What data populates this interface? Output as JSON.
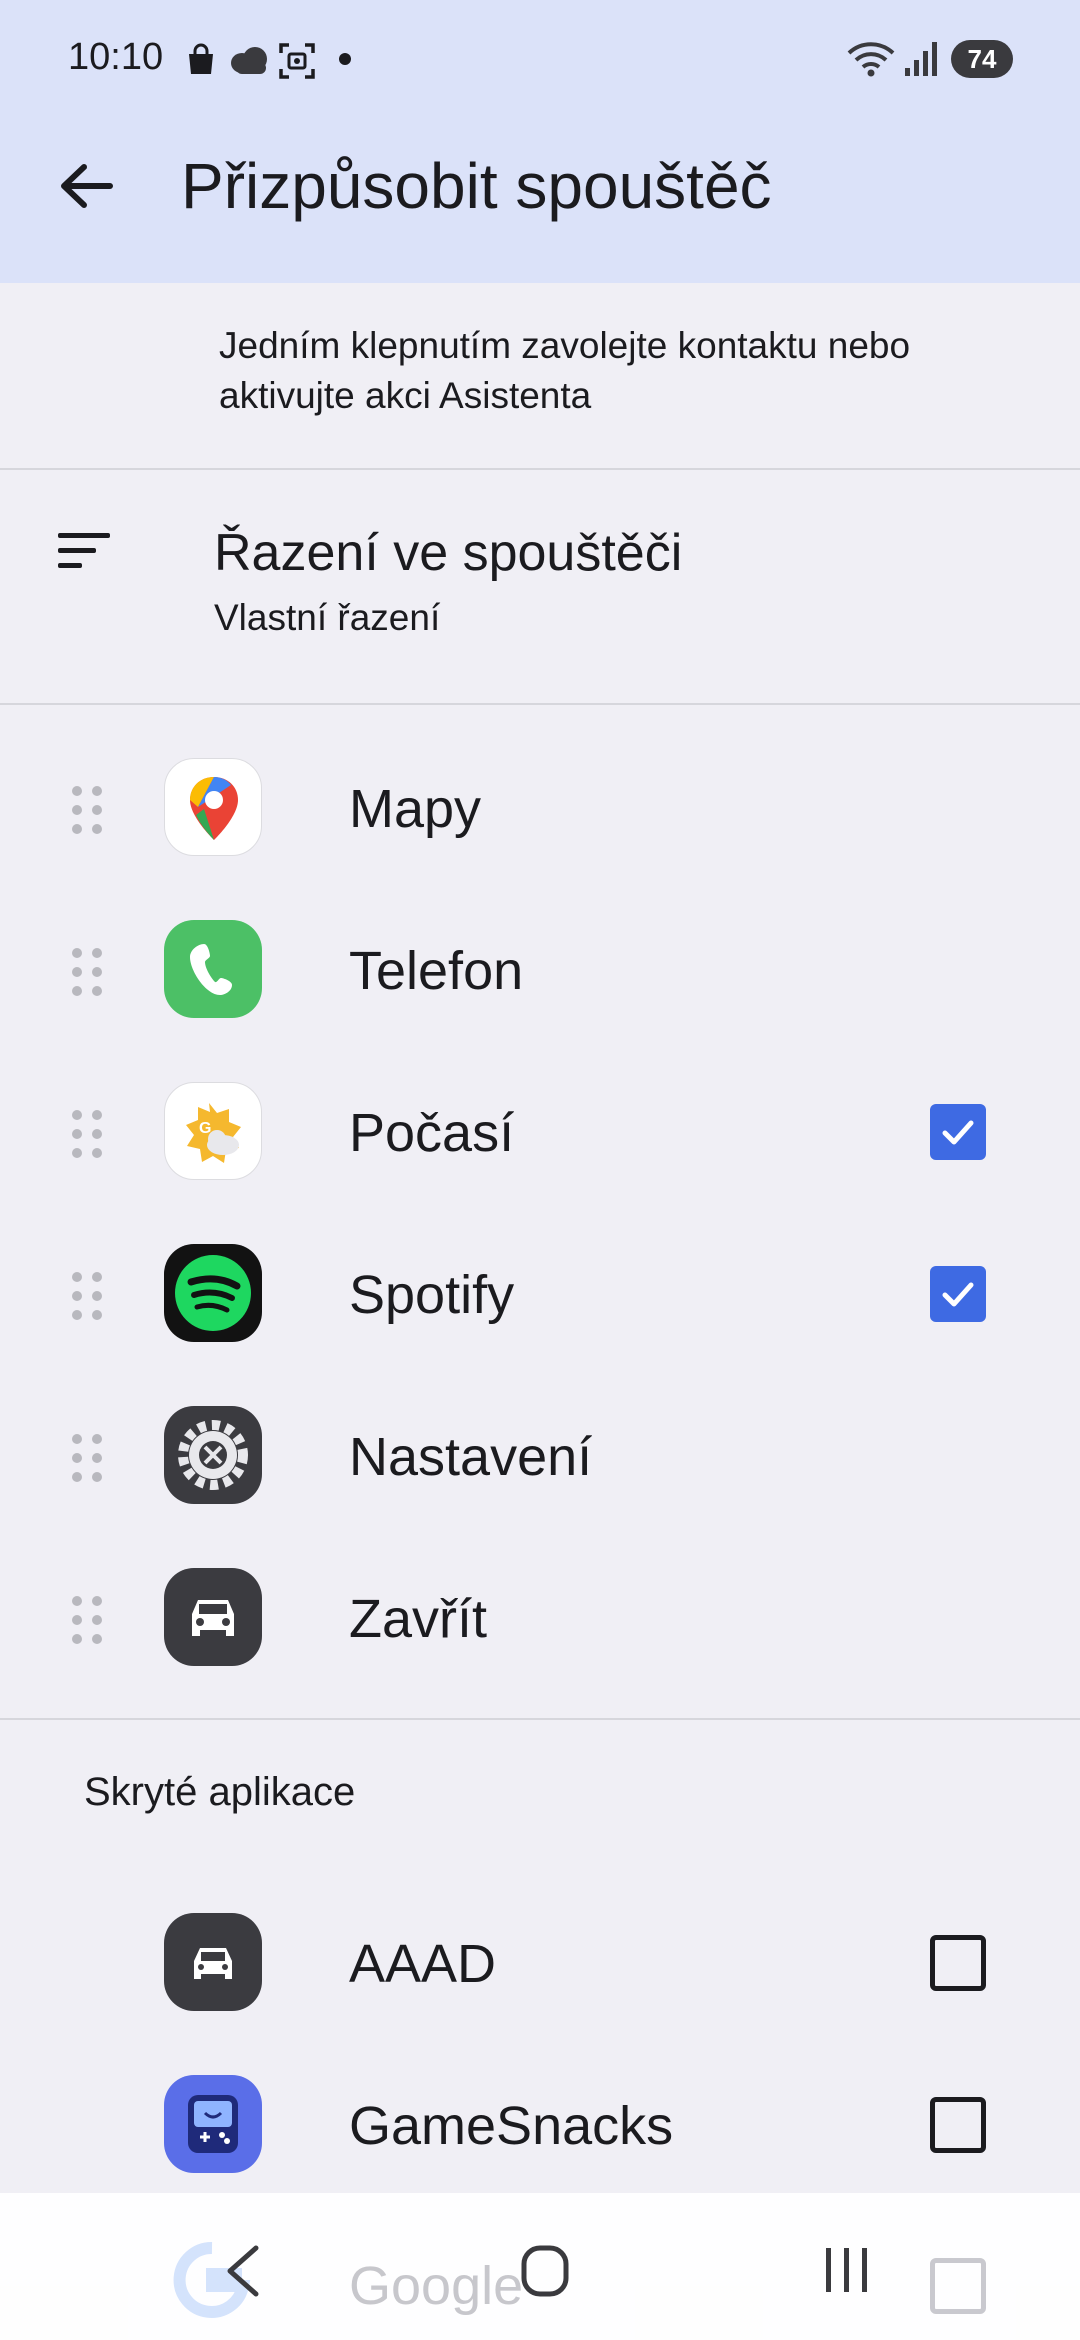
{
  "status_bar": {
    "time": "10:10",
    "battery": "74"
  },
  "app_bar": {
    "title": "Přizpůsobit spouštěč"
  },
  "shortcut_section": {
    "description": "Jedním klepnutím zavolejte kontaktu nebo aktivujte akci Asistenta"
  },
  "sort_setting": {
    "title": "Řazení ve spouštěči",
    "value": "Vlastní řazení"
  },
  "launcher_apps": [
    {
      "label": "Mapy",
      "icon": "maps-icon",
      "checkbox": "none"
    },
    {
      "label": "Telefon",
      "icon": "phone-icon",
      "checkbox": "none"
    },
    {
      "label": "Počasí",
      "icon": "weather-icon",
      "checkbox": "checked"
    },
    {
      "label": "Spotify",
      "icon": "spotify-icon",
      "checkbox": "checked"
    },
    {
      "label": "Nastavení",
      "icon": "settings-icon",
      "checkbox": "none"
    },
    {
      "label": "Zavřít",
      "icon": "car-icon",
      "checkbox": "none"
    }
  ],
  "hidden_section": {
    "title": "Skryté aplikace",
    "apps": [
      {
        "label": "AAAD",
        "icon": "aaad-car-icon",
        "checked": false
      },
      {
        "label": "GameSnacks",
        "icon": "gamesnacks-icon",
        "checked": false
      },
      {
        "label": "Google",
        "icon": "google-icon",
        "checked": false
      }
    ]
  },
  "colors": {
    "top_bar": "#dbe2f9",
    "background": "#f0eff5",
    "accent": "#3e6ae3"
  }
}
